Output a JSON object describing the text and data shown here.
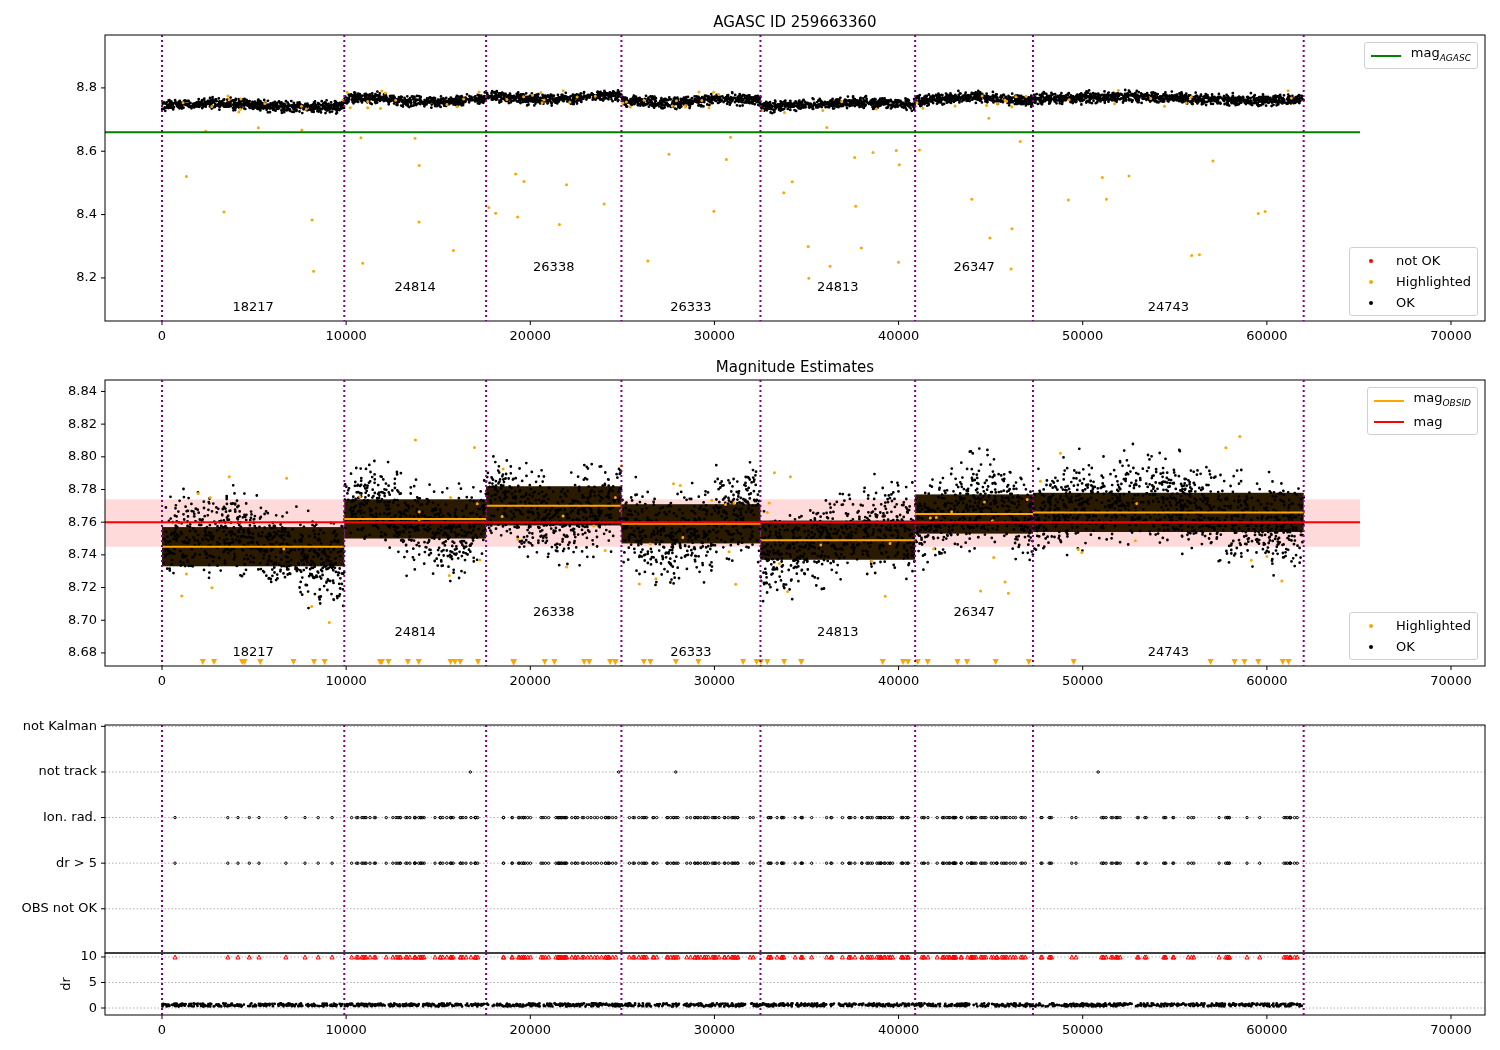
{
  "panels": [
    {
      "title": "AGASC ID 259663360",
      "chart_data": {
        "type": "line",
        "xlim": [
          -3095,
          71846
        ],
        "ylim": [
          8.064,
          8.967
        ],
        "xticks": [
          0,
          10000,
          20000,
          30000,
          40000,
          50000,
          60000,
          70000
        ],
        "yticks": [
          8.2,
          8.4,
          8.6,
          8.8
        ],
        "series": [
          {
            "name": "mag$_{AGASC}$",
            "color": "#008000",
            "x": [
              -3095,
              65060
            ],
            "values": [
              8.66,
              8.66
            ]
          }
        ]
      },
      "point_legend": [
        {
          "label": "not OK",
          "color": "#ff0000"
        },
        {
          "label": "Highlighted",
          "color": "#ffa500"
        },
        {
          "label": "OK",
          "color": "#000000"
        }
      ],
      "obsid_labels": [
        "18217",
        "24814",
        "26338",
        "26333",
        "24813",
        "26347",
        "24743"
      ]
    },
    {
      "title": "Magnitude Estimates",
      "chart_data": {
        "type": "line",
        "xlim": [
          -3095,
          71846
        ],
        "ylim": [
          8.672,
          8.847
        ],
        "xticks": [
          0,
          10000,
          20000,
          30000,
          40000,
          50000,
          60000,
          70000
        ],
        "yticks": [
          {
            "value": 8.68,
            "label": "8.68"
          },
          {
            "value": 8.7,
            "label": "8.70"
          },
          {
            "value": 8.72,
            "label": "8.72"
          },
          {
            "value": 8.74,
            "label": "8.74"
          },
          {
            "value": 8.76,
            "label": "8.76"
          },
          {
            "value": 8.78,
            "label": "8.78"
          },
          {
            "value": 8.8,
            "label": "8.80"
          },
          {
            "value": 8.82,
            "label": "8.82"
          },
          {
            "value": 8.84,
            "label": "8.84"
          }
        ],
        "series": [
          {
            "name": "mag$_{OBSID}$",
            "color": "#ffa500",
            "x": [
              0,
              9900,
              null,
              9900,
              17600,
              null,
              17600,
              24950,
              null,
              24950,
              32500,
              null,
              32500,
              40900,
              null,
              40900,
              47300,
              null,
              47300,
              62000
            ],
            "values": [
              8.745,
              8.745,
              null,
              8.762,
              8.762,
              null,
              8.77,
              8.77,
              null,
              8.759,
              8.759,
              null,
              8.749,
              8.749,
              null,
              8.765,
              8.765,
              null,
              8.766,
              8.766
            ]
          },
          {
            "name": "mag",
            "color": "#ff0000",
            "x": [
              -3095,
              65060
            ],
            "values": [
              8.76,
              8.76
            ]
          }
        ],
        "bands": [
          {
            "axis": "y",
            "from": 8.745,
            "to": 8.774,
            "color": "#ffdada"
          }
        ]
      },
      "point_legend": [
        {
          "label": "Highlighted",
          "color": "#ffa500"
        },
        {
          "label": "OK",
          "color": "#000000"
        }
      ],
      "obsid_labels": [
        "18217",
        "24814",
        "26338",
        "26333",
        "24813",
        "26347",
        "24743"
      ]
    },
    {
      "chart_data": {
        "type": "scatter",
        "xlim": [
          -3095,
          71846
        ],
        "orientation": "horizontal",
        "grid": true,
        "categories": [
          "not Kalman",
          "not track",
          "Ion. rad.",
          "dr > 5",
          "OBS not OK"
        ]
      }
    },
    {
      "chart_data": {
        "type": "scatter",
        "xlim": [
          -3095,
          71846
        ],
        "ylim": [
          -1.37,
          10.78
        ],
        "ylabel": "dr",
        "grid": true,
        "xticks": [
          0,
          10000,
          20000,
          30000,
          40000,
          50000,
          60000,
          70000
        ],
        "yticks": [
          0,
          5,
          10
        ]
      }
    }
  ]
}
